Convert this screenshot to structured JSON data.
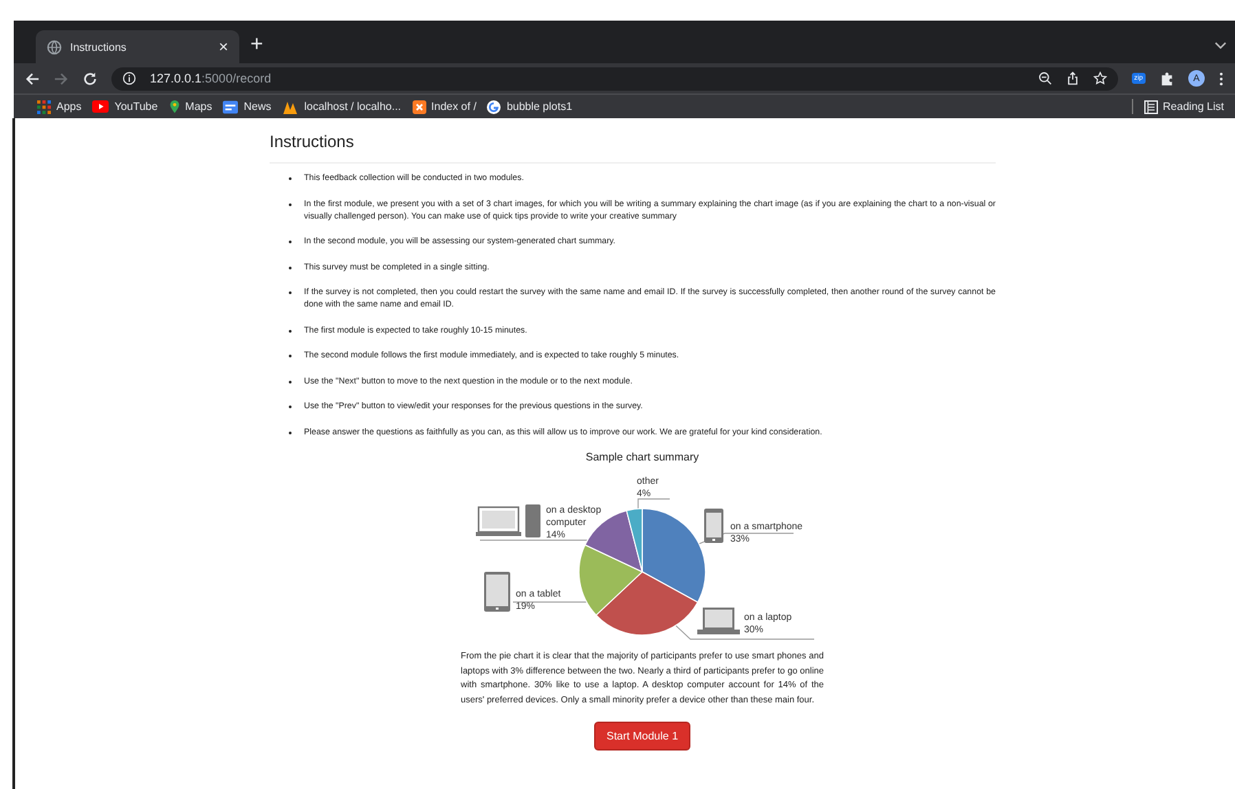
{
  "browser": {
    "tab": {
      "title": "Instructions",
      "close": "×",
      "selected": true
    },
    "new_tab": "+",
    "address": {
      "host": "127.0.0.1",
      "path": ":5000/record"
    },
    "extension_badge": "zip",
    "avatar": "A",
    "bookmarks": [
      {
        "label": "Apps",
        "kind": "apps"
      },
      {
        "label": "YouTube",
        "kind": "youtube"
      },
      {
        "label": "Maps",
        "kind": "maps"
      },
      {
        "label": "News",
        "kind": "news"
      },
      {
        "label": "localhost / localho...",
        "kind": "pma"
      },
      {
        "label": "Index of /",
        "kind": "xampp"
      },
      {
        "label": "bubble plots1",
        "kind": "google"
      }
    ],
    "reading_list": "Reading List"
  },
  "page": {
    "heading": "Instructions",
    "instructions": [
      "This feedback collection will be conducted in two modules.",
      "In the first module, we present you with a set of 3 chart images, for which you will be writing a summary explaining the chart image (as if you are explaining the chart to a non-visual or visually challenged person). You can make use of quick tips provide to write your creative summary",
      "In the second module, you will be assessing our system-generated chart summary.",
      "This survey must be completed in a single sitting.",
      "If the survey is not completed, then you could restart the survey with the same name and email ID. If the survey is successfully completed, then another round of the survey cannot be done with the same name and email ID.",
      "The first module is expected to take roughly 10-15 minutes.",
      "The second module follows the first module immediately, and is expected to take roughly 5 minutes.",
      "Use the \"Next\" button to move to the next question in the module or to the next module.",
      "Use the \"Prev\" button to view/edit your responses for the previous questions in the survey.",
      "Please answer the questions as faithfully as you can, as this will allow us to improve our work. We are grateful for your kind consideration."
    ],
    "sample_title": "Sample chart summary",
    "chart_data": {
      "type": "pie",
      "categories": [
        "on a smartphone",
        "on a laptop",
        "on a tablet",
        "on a desktop computer",
        "other"
      ],
      "values": [
        33,
        30,
        19,
        14,
        4
      ],
      "colors": [
        "#4f81bd",
        "#c0504d",
        "#9bbb59",
        "#8064a2",
        "#4bacc6"
      ],
      "data_labels": true,
      "value_labels": [
        "33%",
        "30%",
        "19%",
        "14%",
        "4%"
      ]
    },
    "summary": "From the pie chart it is clear that the majority of participants prefer to use smart phones and laptops with 3% difference between the two. Nearly a third of participants prefer to go online with smartphone. 30% like to use a laptop. A desktop computer account for 14% of the users' preferred devices. Only a small minority prefer a device other than these main four.",
    "start_button": "Start Module 1"
  }
}
